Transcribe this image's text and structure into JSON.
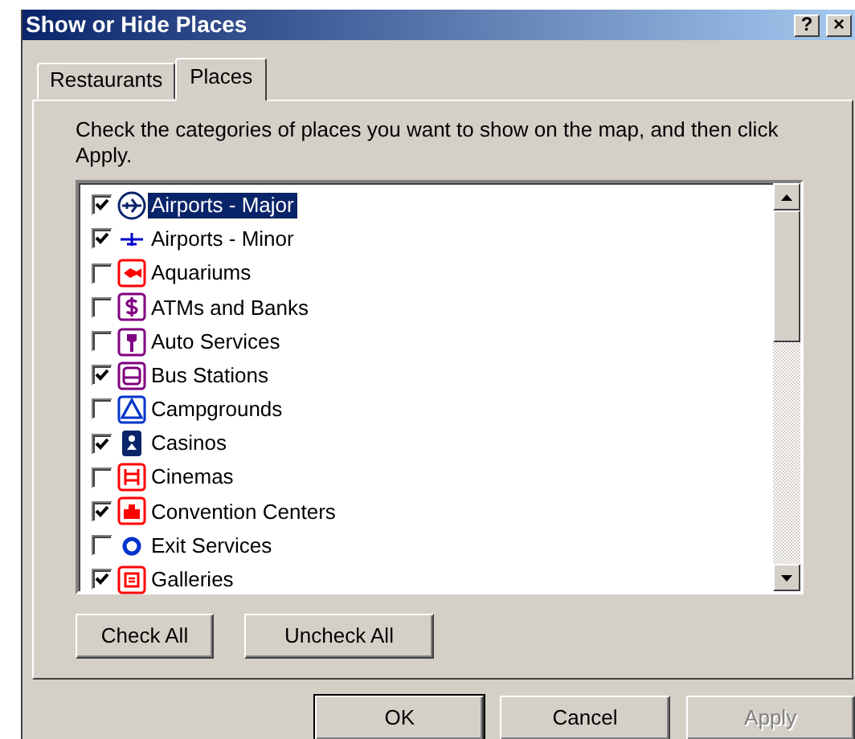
{
  "window": {
    "title": "Show or Hide Places",
    "help_button": "?",
    "close_button": "×"
  },
  "tabs": [
    {
      "label": "Restaurants",
      "selected": false
    },
    {
      "label": "Places",
      "selected": true
    }
  ],
  "instruction": "Check the categories of places you want to show on the map, and then click Apply.",
  "places": [
    {
      "label": "Airports - Major",
      "checked": true,
      "selected": true
    },
    {
      "label": "Airports - Minor",
      "checked": true,
      "selected": false
    },
    {
      "label": "Aquariums",
      "checked": false,
      "selected": false
    },
    {
      "label": "ATMs and Banks",
      "checked": false,
      "selected": false
    },
    {
      "label": "Auto Services",
      "checked": false,
      "selected": false
    },
    {
      "label": "Bus Stations",
      "checked": true,
      "selected": false
    },
    {
      "label": "Campgrounds",
      "checked": false,
      "selected": false
    },
    {
      "label": "Casinos",
      "checked": true,
      "selected": false
    },
    {
      "label": "Cinemas",
      "checked": false,
      "selected": false
    },
    {
      "label": "Convention Centers",
      "checked": true,
      "selected": false
    },
    {
      "label": "Exit Services",
      "checked": false,
      "selected": false
    },
    {
      "label": "Galleries",
      "checked": true,
      "selected": false
    }
  ],
  "list_buttons": [
    {
      "label": "Check All"
    },
    {
      "label": "Uncheck All"
    }
  ],
  "dialog_buttons": [
    {
      "label": "OK",
      "default": true,
      "disabled": false
    },
    {
      "label": "Cancel",
      "default": false,
      "disabled": false
    },
    {
      "label": "Apply",
      "default": false,
      "disabled": true
    }
  ]
}
